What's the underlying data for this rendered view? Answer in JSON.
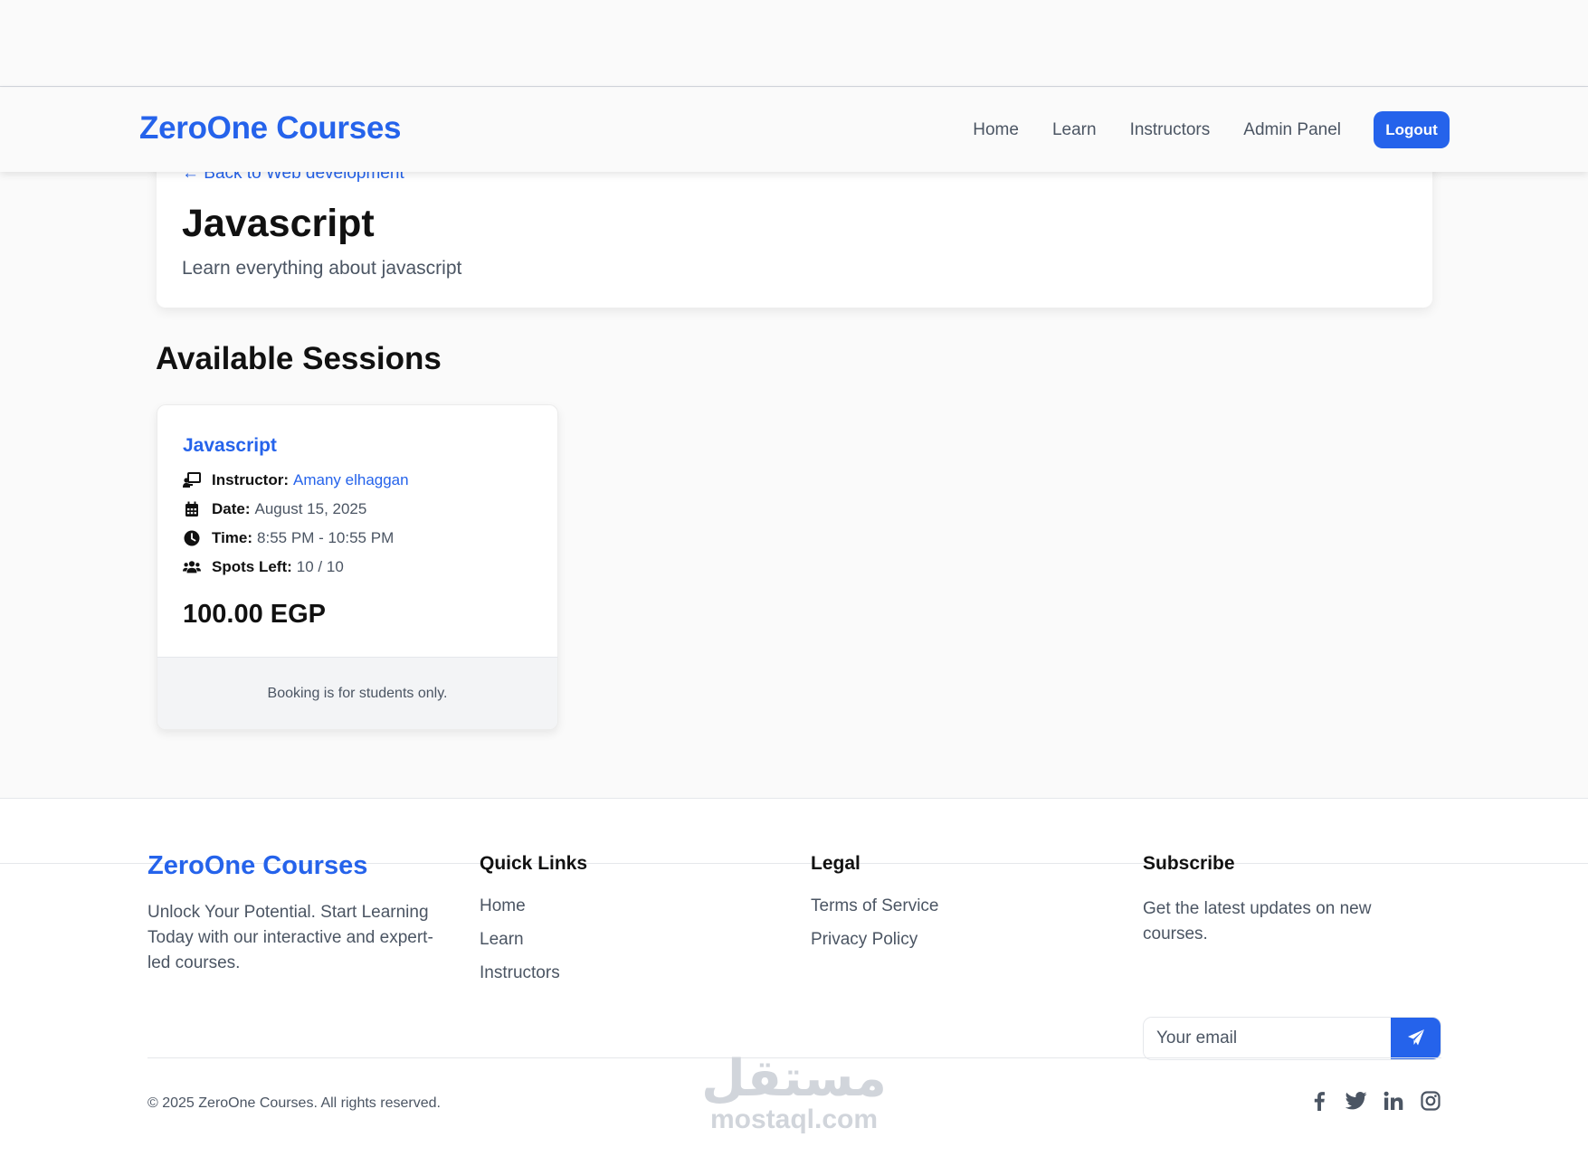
{
  "brand": "ZeroOne Courses",
  "nav": {
    "items": [
      "Home",
      "Learn",
      "Instructors",
      "Admin Panel"
    ],
    "logout_label": "Logout"
  },
  "hero": {
    "back_link": "← Back to Web development",
    "title": "Javascript",
    "description": "Learn everything about javascript"
  },
  "sessions": {
    "heading": "Available Sessions",
    "items": [
      {
        "title": "Javascript",
        "instructor_label": "Instructor:",
        "instructor_name": "Amany elhaggan",
        "date_label": "Date:",
        "date_value": "August 15, 2025",
        "time_label": "Time:",
        "time_value": "8:55 PM - 10:55 PM",
        "spots_label": "Spots Left:",
        "spots_value": "10 / 10",
        "price": "100.00 EGP",
        "footer_note": "Booking is for students only."
      }
    ]
  },
  "footer": {
    "brand": "ZeroOne Courses",
    "tagline": "Unlock Your Potential. Start Learning Today with our interactive and expert-led courses.",
    "quick_links": {
      "heading": "Quick Links",
      "items": [
        "Home",
        "Learn",
        "Instructors"
      ]
    },
    "legal": {
      "heading": "Legal",
      "items": [
        "Terms of Service",
        "Privacy Policy"
      ]
    },
    "subscribe": {
      "heading": "Subscribe",
      "description": "Get the latest updates on new courses.",
      "placeholder": "Your email",
      "button_icon": "paper-plane-icon"
    },
    "copyright": "© 2025 ZeroOne Courses. All rights reserved.",
    "socials": [
      "facebook-icon",
      "twitter-icon",
      "linkedin-icon",
      "instagram-icon"
    ]
  },
  "watermark": {
    "arabic": "مستقل",
    "latin": "mostaql.com"
  },
  "colors": {
    "accent": "#2563eb",
    "text": "#111827",
    "muted": "#4b5563",
    "background": "#fafafa"
  }
}
